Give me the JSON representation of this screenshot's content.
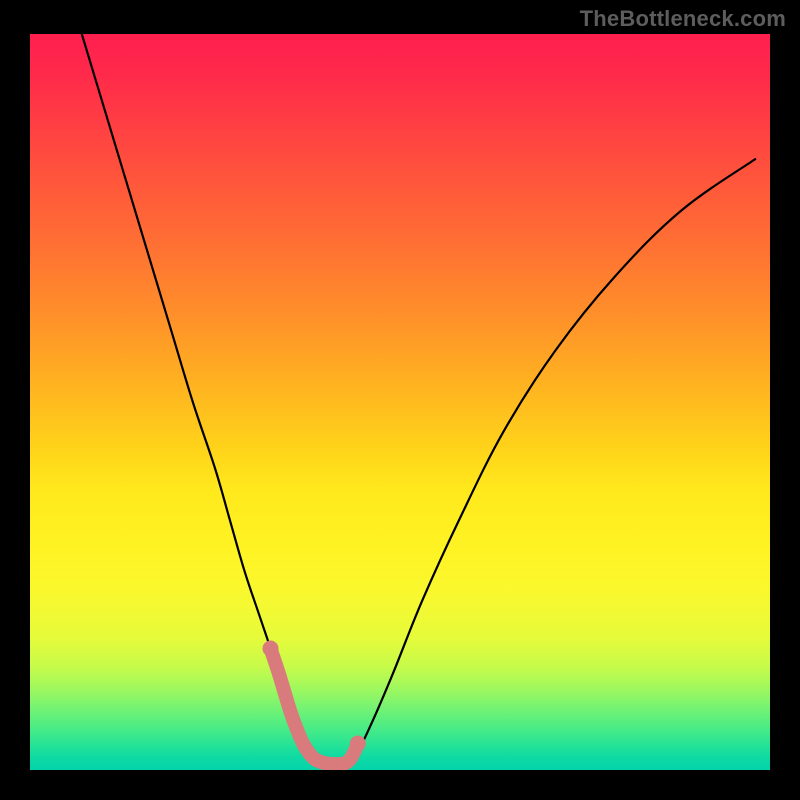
{
  "attribution": "TheBottleneck.com",
  "chart_data": {
    "type": "line",
    "title": "",
    "xlabel": "",
    "ylabel": "",
    "xlim": [
      0,
      100
    ],
    "ylim": [
      0,
      100
    ],
    "series": [
      {
        "name": "bottleneck-curve",
        "x": [
          7,
          10,
          13,
          16,
          19,
          22,
          25,
          27,
          29,
          31,
          33,
          34.5,
          36,
          37,
          38,
          39.5,
          42.5,
          44,
          46,
          49,
          53,
          58,
          64,
          71,
          79,
          88,
          98
        ],
        "values": [
          100,
          90,
          80,
          70,
          60,
          50,
          41,
          34,
          27,
          21,
          15,
          10,
          6,
          3,
          1.5,
          0.8,
          0.8,
          2,
          6,
          13,
          23,
          34,
          46,
          57,
          67,
          76,
          83
        ]
      },
      {
        "name": "highlight-segment",
        "x": [
          32.5,
          33.6,
          34.5,
          35.3,
          36.2,
          37.0,
          37.8,
          38.6,
          40.0,
          41.3,
          42.5,
          43.2,
          43.8,
          44.3
        ],
        "values": [
          16.5,
          13.2,
          10.2,
          7.6,
          5.2,
          3.4,
          2.2,
          1.4,
          0.9,
          0.8,
          0.9,
          1.4,
          2.4,
          3.6
        ]
      }
    ],
    "colors": {
      "curve": "#000000",
      "highlight": "#d97a7c",
      "gradient_top": "#ff1f4f",
      "gradient_bottom": "#04d3aa"
    },
    "notes": "V-shaped bottleneck curve over red-to-green vertical gradient; no axis ticks or legend shown."
  }
}
